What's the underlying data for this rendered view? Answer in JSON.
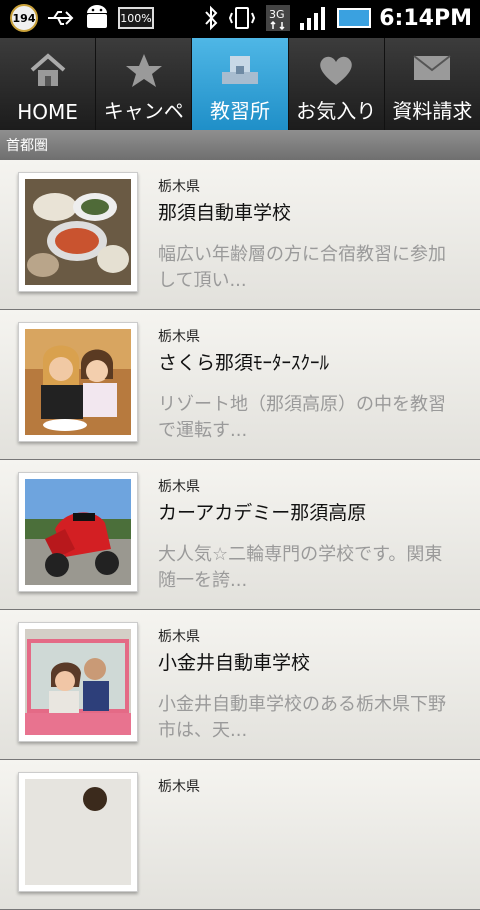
{
  "status": {
    "badge_count": "194",
    "battery_left": "100%",
    "time": "6:14PM"
  },
  "tabs": [
    {
      "label": "HOME",
      "icon": "home-icon",
      "active": false
    },
    {
      "label": "キャンペ",
      "icon": "star-icon",
      "active": false
    },
    {
      "label": "教習所",
      "icon": "school-icon",
      "active": true
    },
    {
      "label": "お気入り",
      "icon": "heart-icon",
      "active": false
    },
    {
      "label": "資料請求",
      "icon": "mail-icon",
      "active": false
    }
  ],
  "section_title": "首都圏",
  "items": [
    {
      "prefecture": "栃木県",
      "title": "那須自動車学校",
      "description": "幅広い年齢層の方に合宿教習に参加して頂い..."
    },
    {
      "prefecture": "栃木県",
      "title": "さくら那須ﾓｰﾀｰｽｸｰﾙ",
      "description": "リゾート地（那須高原）の中を教習で運転す..."
    },
    {
      "prefecture": "栃木県",
      "title": "カーアカデミー那須高原",
      "description": "大人気☆二輪専門の学校です。関東随一を誇..."
    },
    {
      "prefecture": "栃木県",
      "title": "小金井自動車学校",
      "description": "小金井自動車学校のある栃木県下野市は、天..."
    },
    {
      "prefecture": "栃木県",
      "title": "",
      "description": ""
    }
  ]
}
